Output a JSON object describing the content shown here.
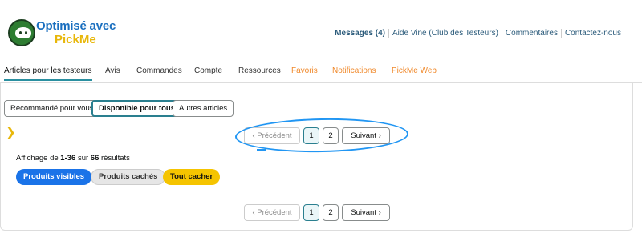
{
  "logo": {
    "line1": "Optimisé avec",
    "line2": "PickMe"
  },
  "header": {
    "links": [
      "Messages (4)",
      "Aide Vine (Club des Testeurs)",
      "Commentaires",
      "Contactez-nous"
    ]
  },
  "nav": {
    "items": [
      "Articles pour les testeurs",
      "Avis",
      "Commandes",
      "Compte",
      "Ressources",
      "Favoris",
      "Notifications",
      "PickMe Web"
    ],
    "active": "Articles pour les testeurs"
  },
  "tabs": {
    "items": [
      "Recommandé pour vous",
      "Disponible pour tous",
      "Autres articles"
    ],
    "active": "Disponible pour tous"
  },
  "pagination": {
    "prev": "‹  Précédent",
    "pages": [
      "1",
      "2"
    ],
    "current": "1",
    "next": "Suivant  ›"
  },
  "results": {
    "prefix": "Affichage de ",
    "range": "1-36",
    "middle": " sur ",
    "total": "66",
    "suffix": " résultats"
  },
  "filters": {
    "visible": "Produits visibles",
    "hidden": "Produits cachés",
    "hide_all": "Tout cacher"
  },
  "colors": {
    "accent": "#2a7f8f",
    "orange_nav": "#f0892b",
    "blue_pill": "#1a73e8",
    "yellow_pill": "#f5c400",
    "annotation": "#2196f3"
  }
}
